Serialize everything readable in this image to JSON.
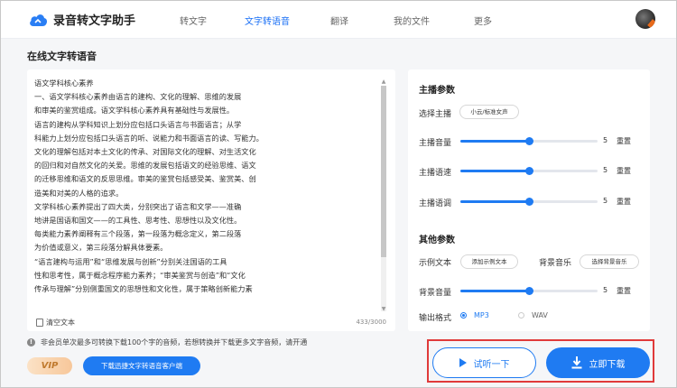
{
  "app": {
    "name": "录音转文字助手"
  },
  "nav": [
    {
      "label": "转文字",
      "active": false
    },
    {
      "label": "文字转语音",
      "active": true
    },
    {
      "label": "翻译",
      "active": false
    },
    {
      "label": "我的文件",
      "active": false
    },
    {
      "label": "更多",
      "active": false
    }
  ],
  "page_title": "在线文字转语音",
  "editor": {
    "lines": [
      "语文学科核心素养",
      "一、语文学科核心素养由语言的建构、文化的理解、思维的发展",
      "和审美的鉴赏组成。语文学科核心素养具有基础性与发展性。",
      "语言的建构从学科知识上划分应包括口头语言与书面语言；从学",
      "科能力上划分应包括口头语言的听、说能力和书面语言的读、写能力。",
      "文化的理解包括对本土文化的传承、对国际文化的理解、对生活文化",
      "的回归和对自然文化的关爱。思维的发展包括语文的经验思维、语文",
      "的迁移思维和语文的反思思维。审美的鉴赏包括感受美、鉴赏美、创",
      "造美和对美的人格的追求。",
      "文学科核心素养提出了四大类，分别突出了语言和文学——准确",
      "地讲是国语和国文——的工具性、思考性、思想性以及文化性。",
      "每类能力素养阐释有三个段落，第一段落为概念定义，第二段落",
      "为价值或意义，第三段落分解具体要素。",
      "“语言建构与运用”和“思维发展与创新”分别关注国语的工具",
      "性和思考性，属于概念程序能力素养；“审美鉴赏与创造”和“文化",
      "传承与理解”分别侧重国文的思想性和文化性，属于策略创新能力素"
    ],
    "clear_label": "清空文本",
    "char_count": "433/3000"
  },
  "notice": "非会员单次最多可转换下载100个字的音频，若想转换并下载更多文字音频，请开通",
  "vip_label": "VIP",
  "download_client_label": "下载迅捷文字转语音客户端",
  "settings": {
    "host_title": "主播参数",
    "select_host_label": "选择主播",
    "host_value": "小云/标准女声",
    "volume": {
      "label": "主播音量",
      "value": "5",
      "level": 0.5
    },
    "speed": {
      "label": "主播语速",
      "value": "5",
      "level": 0.5
    },
    "pitch": {
      "label": "主播语调",
      "value": "5",
      "level": 0.5
    },
    "reset_label": "重置",
    "other_title": "其他参数",
    "example_label": "示例文本",
    "example_button": "添加示例文本",
    "bgm_label": "背景音乐",
    "bgm_button": "选择背景音乐",
    "bg_volume": {
      "label": "背景音量",
      "value": "5",
      "level": 0.5
    },
    "format_label": "输出格式",
    "formats": [
      {
        "label": "MP3",
        "selected": true
      },
      {
        "label": "WAV",
        "selected": false
      }
    ]
  },
  "actions": {
    "listen_label": "试听一下",
    "download_label": "立即下载"
  },
  "colors": {
    "accent": "#1f7bf2",
    "highlight_box": "#e03a3a"
  }
}
